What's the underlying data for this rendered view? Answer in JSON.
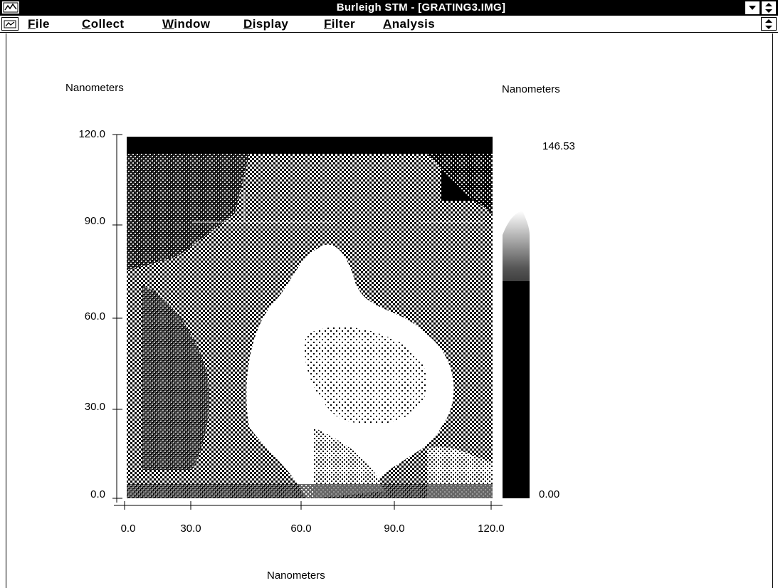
{
  "window": {
    "title": "Burleigh STM - [GRATING3.IMG]"
  },
  "menu": {
    "items": [
      {
        "id": "file",
        "label": "File",
        "underline": "F",
        "rest": "ile"
      },
      {
        "id": "collect",
        "label": "Collect",
        "underline": "C",
        "rest": "ollect"
      },
      {
        "id": "window",
        "label": "Window",
        "underline": "W",
        "rest": "indow"
      },
      {
        "id": "display",
        "label": "Display",
        "underline": "D",
        "rest": "isplay"
      },
      {
        "id": "filter",
        "label": "Filter",
        "underline": "F",
        "rest": "ilter"
      },
      {
        "id": "analysis",
        "label": "Analysis",
        "underline": "A",
        "rest": "nalysis"
      }
    ]
  },
  "plot": {
    "y_axis_label": "Nanometers",
    "x_axis_label": "Nanometers",
    "scale_label": "Nanometers",
    "y_ticks": [
      "120.0",
      "90.0",
      "60.0",
      "30.0",
      "0.0"
    ],
    "x_ticks": [
      "0.0",
      "30.0",
      "60.0",
      "90.0",
      "120.0"
    ],
    "scale_max": "146.53",
    "scale_min": "0.00"
  },
  "icons": {
    "system_menu": "window-menu-icon",
    "document_menu": "document-control-icon",
    "restore": "restore-icon",
    "minimize": "minimize-icon",
    "mdi_restore": "mdi-restore-icon"
  }
}
